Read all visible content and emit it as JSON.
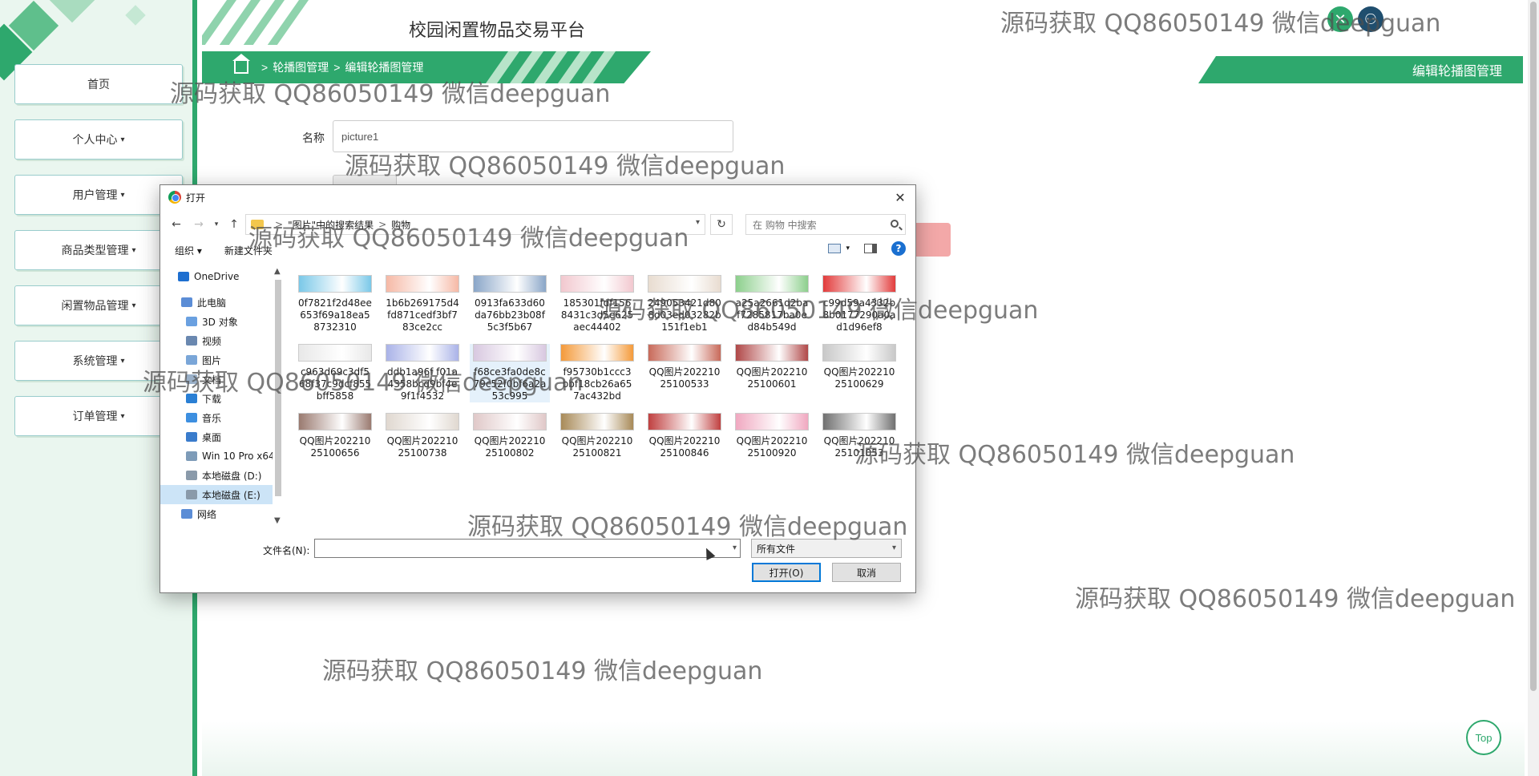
{
  "app": {
    "title": "校园闲置物品交易平台"
  },
  "sidebar": {
    "items": [
      {
        "label": "首页",
        "dropdown": false
      },
      {
        "label": "个人中心",
        "dropdown": true
      },
      {
        "label": "用户管理",
        "dropdown": true
      },
      {
        "label": "商品类型管理",
        "dropdown": true
      },
      {
        "label": "闲置物品管理",
        "dropdown": true
      },
      {
        "label": "系统管理",
        "dropdown": true
      },
      {
        "label": "订单管理",
        "dropdown": true
      }
    ]
  },
  "breadcrumb": {
    "sep": ">",
    "items": [
      "轮播图管理",
      "编辑轮播图管理"
    ]
  },
  "page_tag": "编辑轮播图管理",
  "form": {
    "name_label": "名称",
    "name_value": "picture1"
  },
  "top_button": "Top",
  "dialog": {
    "title": "打开",
    "address": {
      "parts": [
        "\"图片\"中的搜索结果",
        "购物"
      ],
      "sep": ">"
    },
    "search_placeholder": "在 购物 中搜索",
    "toolbar": {
      "organize": "组织 ▾",
      "new_folder": "新建文件夹",
      "help": "?"
    },
    "tree": [
      {
        "label": "OneDrive",
        "color": "#1e6fd0",
        "level": "top"
      },
      {
        "label": "此电脑",
        "color": "#5b8dd6",
        "level": "1"
      },
      {
        "label": "3D 对象",
        "color": "#6aa0e0",
        "level": "2"
      },
      {
        "label": "视频",
        "color": "#6a88b0",
        "level": "2"
      },
      {
        "label": "图片",
        "color": "#7aa6d8",
        "level": "2"
      },
      {
        "label": "文档",
        "color": "#9ab0c8",
        "level": "2"
      },
      {
        "label": "下载",
        "color": "#2a7fd4",
        "level": "2"
      },
      {
        "label": "音乐",
        "color": "#3d8fe0",
        "level": "2"
      },
      {
        "label": "桌面",
        "color": "#3a7ccc",
        "level": "2"
      },
      {
        "label": "Win 10 Pro x64",
        "color": "#7d9bb8",
        "level": "2"
      },
      {
        "label": "本地磁盘 (D:)",
        "color": "#8a9aaa",
        "level": "2"
      },
      {
        "label": "本地磁盘 (E:)",
        "color": "#8a9aaa",
        "level": "2",
        "selected": true
      },
      {
        "label": "网络",
        "color": "#5b8dd6",
        "level": "1"
      }
    ],
    "files": [
      {
        "name": "0f7821f2d48ee653f69a18ea58732310",
        "color": "#7ac8e8"
      },
      {
        "name": "1b6b269175d4fd871cedf3bf783ce2cc",
        "color": "#f6b9a6"
      },
      {
        "name": "0913fa633d60da76bb23b08f5c3f5b67",
        "color": "#8aa6c8"
      },
      {
        "name": "185301fdf1568431c3d5e625aec44402",
        "color": "#f2c8cf"
      },
      {
        "name": "249053421d808d03ed03282b151f1eb1",
        "color": "#e8dcd0"
      },
      {
        "name": "a25a2661d2baf7285817ba0ed84b549d",
        "color": "#8ccf8c"
      },
      {
        "name": "c99d59a4332b8b0177290a0ad1d96ef8",
        "color": "#e23b3b"
      },
      {
        "name": "c963d69c3df568f37c9dcf855bff5858",
        "color": "#e8e8e8"
      },
      {
        "name": "ddb1a96f f01a4358bcd9bf4e9f1f4532",
        "color": "#aab3e8"
      },
      {
        "name": "f68ce3fa0de8c79c52f0bf6a2a53c995",
        "color": "#d8c8e0"
      },
      {
        "name": "f95730b1ccc3bbf18cb26a657ac432bd",
        "color": "#f49a3a"
      },
      {
        "name": "QQ图片20221025100533",
        "color": "#c86a5a"
      },
      {
        "name": "QQ图片20221025100601",
        "color": "#b04848"
      },
      {
        "name": "QQ图片20221025100629",
        "color": "#c8c8c8"
      },
      {
        "name": "QQ图片20221025100656",
        "color": "#9a7a70"
      },
      {
        "name": "QQ图片20221025100738",
        "color": "#e0d8d0"
      },
      {
        "name": "QQ图片20221025100802",
        "color": "#e0c8c8"
      },
      {
        "name": "QQ图片20221025100821",
        "color": "#a88a58"
      },
      {
        "name": "QQ图片20221025100846",
        "color": "#c04040"
      },
      {
        "name": "QQ图片20221025100920",
        "color": "#f0a8c0"
      },
      {
        "name": "QQ图片20221025101053",
        "color": "#707070"
      }
    ],
    "file_name_label": "文件名(N):",
    "file_name_value": "",
    "file_type": "所有文件",
    "open_button": "打开(O)",
    "cancel_button": "取消"
  },
  "watermark": "源码获取 QQ86050149 微信deepguan",
  "colors": {
    "accent": "#2ea86d",
    "sidebar_bg": "#eaf6ef",
    "danger_light": "#f3a8a8"
  }
}
